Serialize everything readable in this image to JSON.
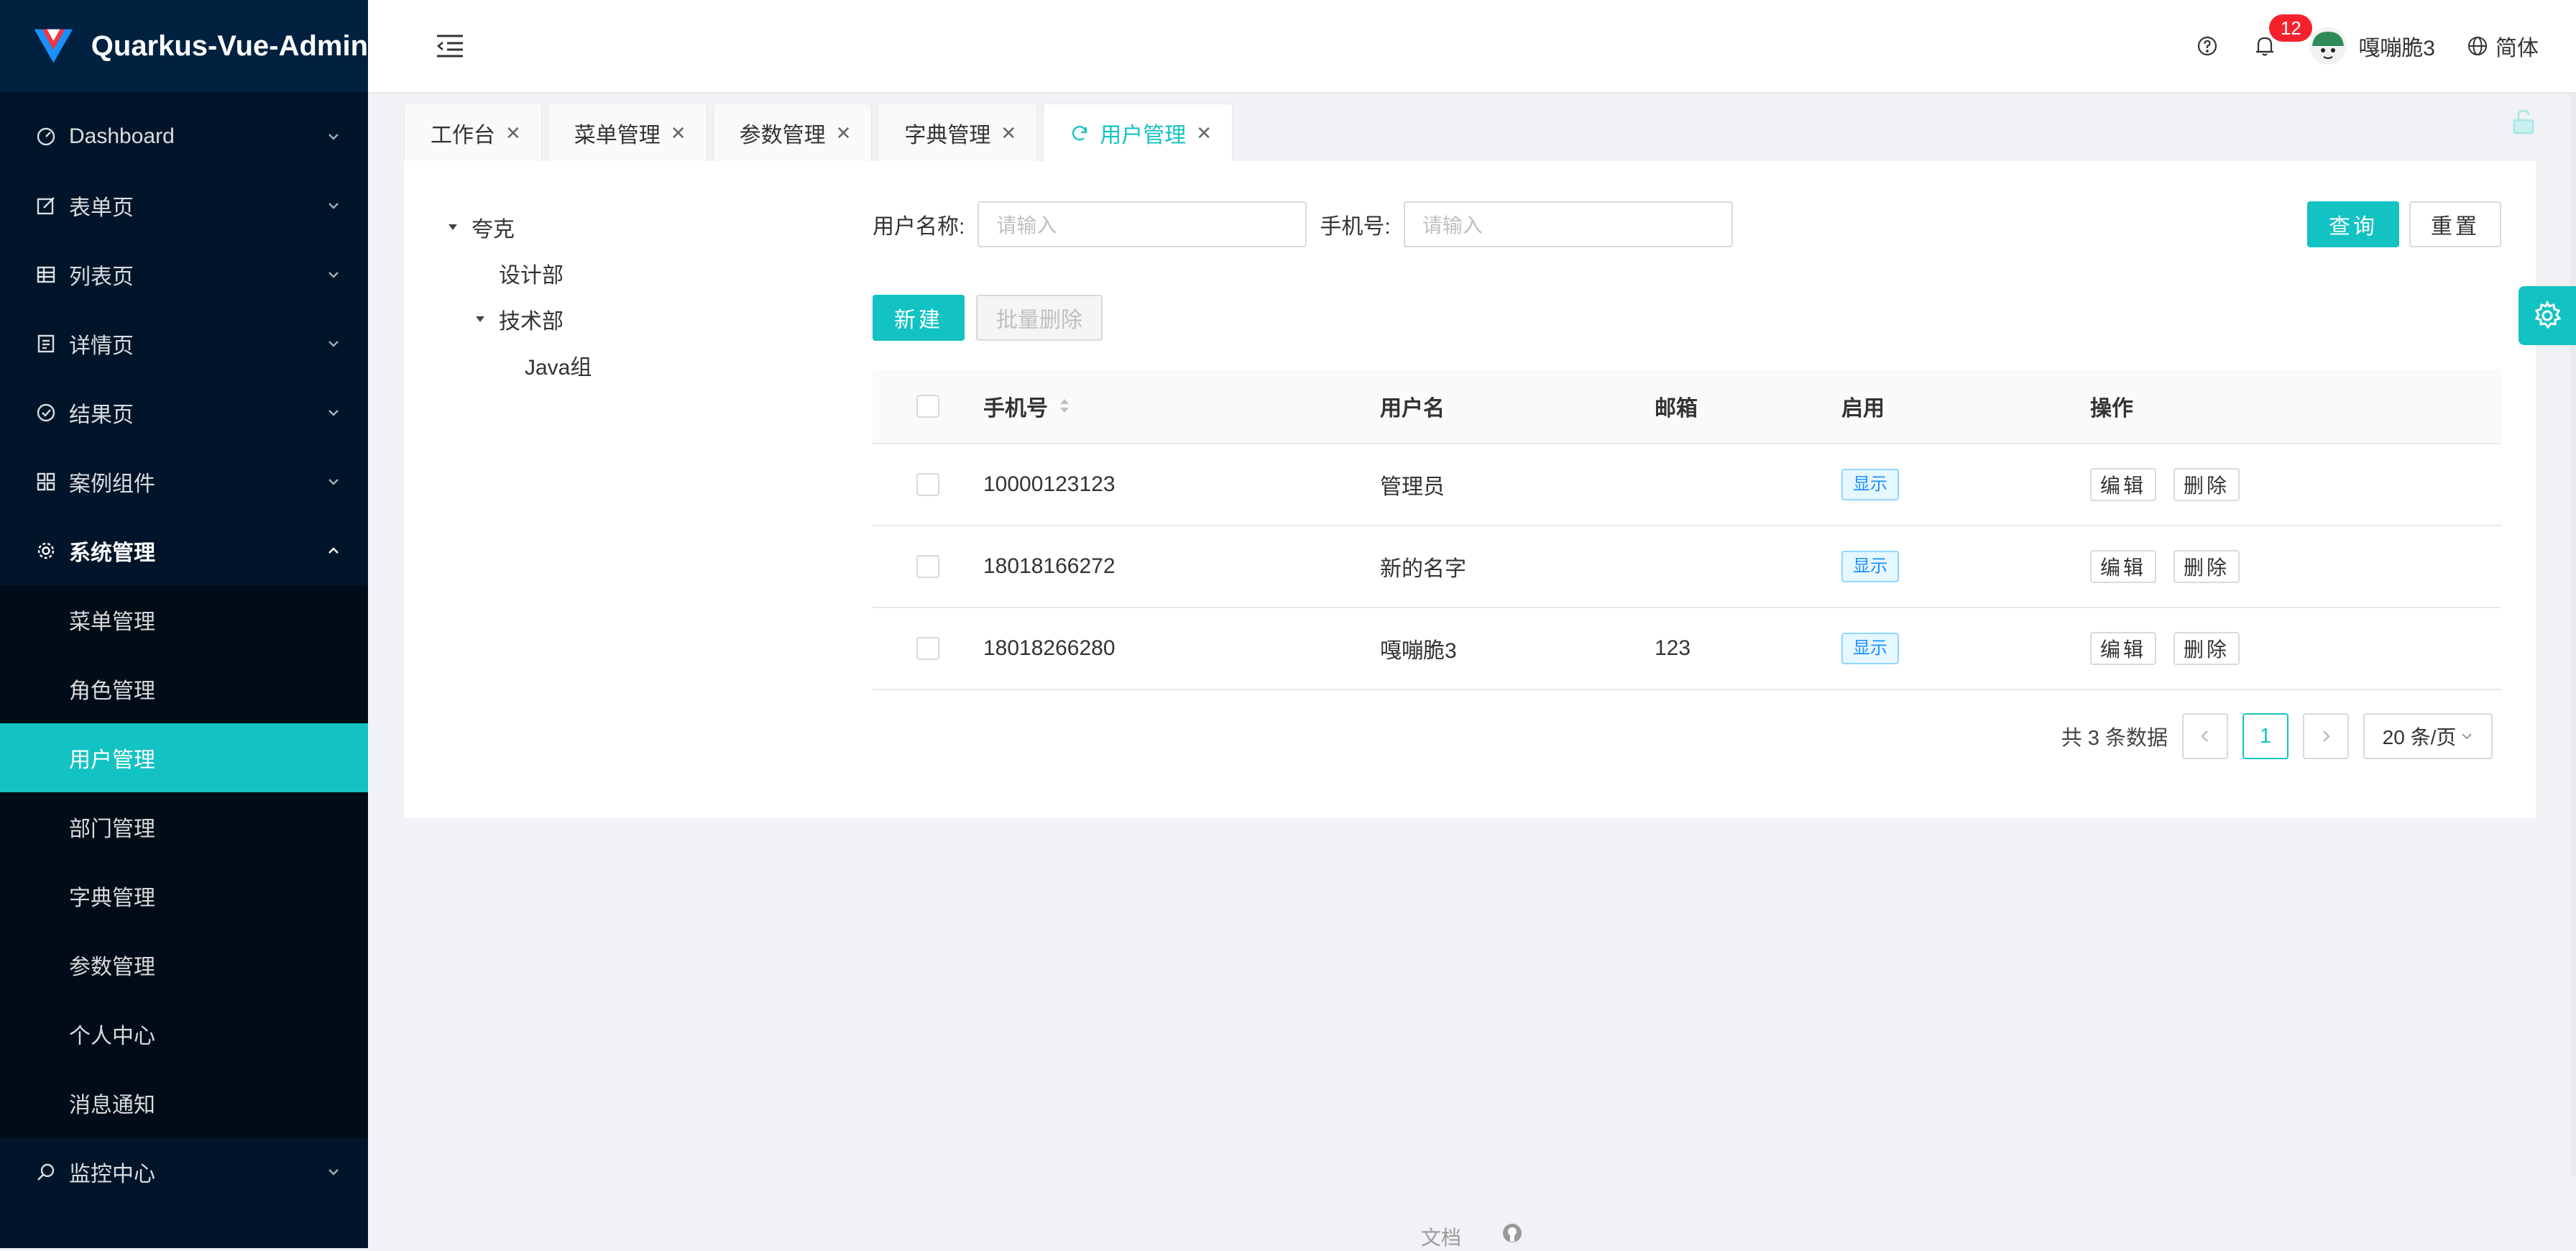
{
  "brand": {
    "title": "Quarkus-Vue-Admin"
  },
  "sidebar": {
    "items": [
      {
        "label": "Dashboard",
        "icon": "dashboard-icon"
      },
      {
        "label": "表单页",
        "icon": "form-icon"
      },
      {
        "label": "列表页",
        "icon": "table-icon"
      },
      {
        "label": "详情页",
        "icon": "profile-icon"
      },
      {
        "label": "结果页",
        "icon": "check-circle-icon"
      },
      {
        "label": "案例组件",
        "icon": "appstore-icon"
      },
      {
        "label": "系统管理",
        "icon": "setting-icon"
      }
    ],
    "submenu": [
      {
        "label": "菜单管理"
      },
      {
        "label": "角色管理"
      },
      {
        "label": "用户管理",
        "active": true
      },
      {
        "label": "部门管理"
      },
      {
        "label": "字典管理"
      },
      {
        "label": "参数管理"
      },
      {
        "label": "个人中心"
      },
      {
        "label": "消息通知"
      }
    ],
    "monitor": {
      "label": "监控中心",
      "icon": "monitor-icon"
    }
  },
  "header": {
    "notification_count": "12",
    "user_name": "嘎嘣脆3",
    "language": "简体"
  },
  "tabs": [
    {
      "label": "工作台"
    },
    {
      "label": "菜单管理"
    },
    {
      "label": "参数管理"
    },
    {
      "label": "字典管理"
    },
    {
      "label": "用户管理",
      "active": true
    }
  ],
  "tree": {
    "root": "夸克",
    "children": [
      {
        "label": "设计部"
      },
      {
        "label": "技术部",
        "children": [
          {
            "label": "Java组"
          }
        ]
      }
    ]
  },
  "search": {
    "username_label": "用户名称:",
    "username_placeholder": "请输入",
    "phone_label": "手机号:",
    "phone_placeholder": "请输入",
    "query_label": "查询",
    "reset_label": "重置"
  },
  "actions": {
    "new_label": "新建",
    "batch_delete_label": "批量删除"
  },
  "table": {
    "columns": [
      "手机号",
      "用户名",
      "邮箱",
      "启用",
      "操作"
    ],
    "rows": [
      {
        "phone": "10000123123",
        "username": "管理员",
        "email": "",
        "enabled": "显示"
      },
      {
        "phone": "18018166272",
        "username": "新的名字",
        "email": "",
        "enabled": "显示"
      },
      {
        "phone": "18018266280",
        "username": "嘎嘣脆3",
        "email": "123",
        "enabled": "显示"
      }
    ],
    "edit_label": "编辑",
    "delete_label": "删除"
  },
  "pagination": {
    "total_text": "共 3 条数据",
    "current_page": "1",
    "page_size": "20 条/页"
  },
  "footer": {
    "docs_label": "文档"
  },
  "colors": {
    "accent": "#13c2c2",
    "sidebar_bg": "#001529",
    "badge": "#f5222d"
  }
}
